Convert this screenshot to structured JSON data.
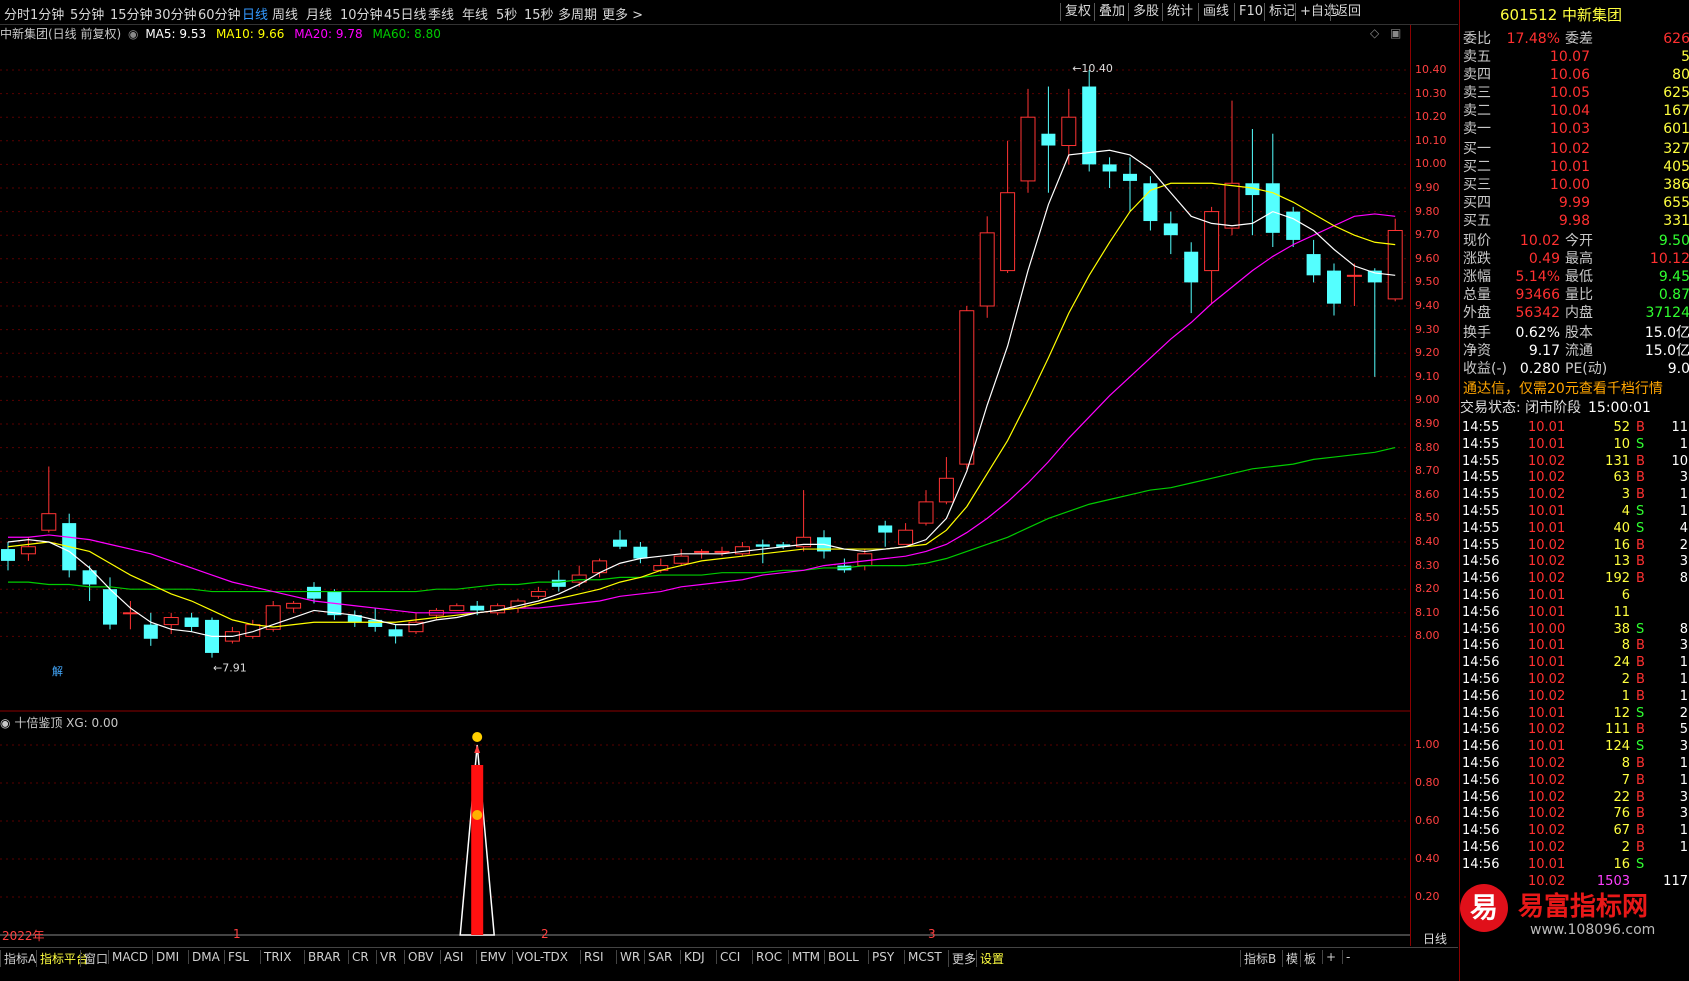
{
  "periods": [
    "分时",
    "1分钟",
    "5分钟",
    "15分钟",
    "30分钟",
    "60分钟",
    "日线",
    "周线",
    "月线",
    "10分钟",
    "45日线",
    "季线",
    "年线",
    "5秒",
    "15秒",
    "多周期",
    "更多 >"
  ],
  "right_buttons": [
    "复权",
    "叠加",
    "多股",
    "统计",
    "画线",
    "F10",
    "标记",
    "+自选",
    "返回"
  ],
  "title_line": {
    "name": "中新集团(日线 前复权)",
    "ma5": "MA5: 9.53",
    "ma10": "MA10: 9.66",
    "ma20": "MA20: 9.78",
    "ma60": "MA60: 8.80"
  },
  "colors": {
    "ma5": "#ffffff",
    "ma10": "#ffff00",
    "ma20": "#ff00ff",
    "ma60": "#00cc00",
    "up": "#ff3333",
    "down": "#54ffff"
  },
  "price_ticks": [
    "10.40",
    "10.30",
    "10.20",
    "10.10",
    "10.00",
    "9.90",
    "9.80",
    "9.70",
    "9.60",
    "9.50",
    "9.40",
    "9.30",
    "9.20",
    "9.10",
    "9.00",
    "8.90",
    "8.80",
    "8.70",
    "8.60",
    "8.50",
    "8.40",
    "8.30",
    "8.20",
    "8.10",
    "8.00"
  ],
  "annotations": {
    "high": "10.40",
    "low": "7.91",
    "jie": "解"
  },
  "sub": {
    "title": "十倍鉴顶 XG: 0.00",
    "ticks": [
      "1.00",
      "0.80",
      "0.60",
      "0.40",
      "0.20"
    ]
  },
  "date_labels": [
    "2022年",
    "1",
    "2",
    "3"
  ],
  "stock_header": "601512 中新集团",
  "weibi": {
    "label": "委比",
    "value": "17.48%",
    "label2": "委差",
    "value2": "626"
  },
  "order_book": [
    {
      "label": "卖五",
      "price": "10.07",
      "vol": "5"
    },
    {
      "label": "卖四",
      "price": "10.06",
      "vol": "80"
    },
    {
      "label": "卖三",
      "price": "10.05",
      "vol": "625"
    },
    {
      "label": "卖二",
      "price": "10.04",
      "vol": "167"
    },
    {
      "label": "卖一",
      "price": "10.03",
      "vol": "601"
    },
    {
      "label": "买一",
      "price": "10.02",
      "vol": "327"
    },
    {
      "label": "买二",
      "price": "10.01",
      "vol": "405"
    },
    {
      "label": "买三",
      "price": "10.00",
      "vol": "386"
    },
    {
      "label": "买四",
      "price": "9.99",
      "vol": "655"
    },
    {
      "label": "买五",
      "price": "9.98",
      "vol": "331"
    }
  ],
  "quote": [
    {
      "l1": "现价",
      "v1": "10.02",
      "l2": "今开",
      "v2": "9.50"
    },
    {
      "l1": "涨跌",
      "v1": "0.49",
      "l2": "最高",
      "v2": "10.12"
    },
    {
      "l1": "涨幅",
      "v1": "5.14%",
      "l2": "最低",
      "v2": "9.45"
    },
    {
      "l1": "总量",
      "v1": "93466",
      "l2": "量比",
      "v2": "0.87"
    },
    {
      "l1": "外盘",
      "v1": "56342",
      "l2": "内盘",
      "v2": "37124"
    }
  ],
  "info": [
    {
      "l1": "换手",
      "v1": "0.62%",
      "l2": "股本",
      "v2": "15.0亿"
    },
    {
      "l1": "净资",
      "v1": "9.17",
      "l2": "流通",
      "v2": "15.0亿"
    },
    {
      "l1": "收益(-)",
      "v1": "0.280",
      "l2": "PE(动)",
      "v2": "9.0"
    }
  ],
  "promo": "通达信，仅需20元查看千档行情",
  "trade_status": {
    "label": "交易状态: 闭市阶段",
    "time": "15:00:01"
  },
  "ticks": [
    {
      "t": "14:55",
      "p": "10.01",
      "v": "52",
      "d": "B",
      "n": "11"
    },
    {
      "t": "14:55",
      "p": "10.01",
      "v": "10",
      "d": "S",
      "n": "1"
    },
    {
      "t": "14:55",
      "p": "10.02",
      "v": "131",
      "d": "B",
      "n": "10"
    },
    {
      "t": "14:55",
      "p": "10.02",
      "v": "63",
      "d": "B",
      "n": "3"
    },
    {
      "t": "14:55",
      "p": "10.02",
      "v": "3",
      "d": "B",
      "n": "1"
    },
    {
      "t": "14:55",
      "p": "10.01",
      "v": "4",
      "d": "S",
      "n": "1"
    },
    {
      "t": "14:55",
      "p": "10.01",
      "v": "40",
      "d": "S",
      "n": "4"
    },
    {
      "t": "14:55",
      "p": "10.02",
      "v": "16",
      "d": "B",
      "n": "2"
    },
    {
      "t": "14:56",
      "p": "10.02",
      "v": "13",
      "d": "B",
      "n": "3"
    },
    {
      "t": "14:56",
      "p": "10.02",
      "v": "192",
      "d": "B",
      "n": "8"
    },
    {
      "t": "14:56",
      "p": "10.01",
      "v": "6",
      "d": "",
      "n": ""
    },
    {
      "t": "14:56",
      "p": "10.01",
      "v": "11",
      "d": "",
      "n": ""
    },
    {
      "t": "14:56",
      "p": "10.00",
      "v": "38",
      "d": "S",
      "n": "8"
    },
    {
      "t": "14:56",
      "p": "10.01",
      "v": "8",
      "d": "B",
      "n": "3"
    },
    {
      "t": "14:56",
      "p": "10.01",
      "v": "24",
      "d": "B",
      "n": "1"
    },
    {
      "t": "14:56",
      "p": "10.02",
      "v": "2",
      "d": "B",
      "n": "1"
    },
    {
      "t": "14:56",
      "p": "10.02",
      "v": "1",
      "d": "B",
      "n": "1"
    },
    {
      "t": "14:56",
      "p": "10.01",
      "v": "12",
      "d": "S",
      "n": "2"
    },
    {
      "t": "14:56",
      "p": "10.02",
      "v": "111",
      "d": "B",
      "n": "5"
    },
    {
      "t": "14:56",
      "p": "10.01",
      "v": "124",
      "d": "S",
      "n": "3"
    },
    {
      "t": "14:56",
      "p": "10.02",
      "v": "8",
      "d": "B",
      "n": "1"
    },
    {
      "t": "14:56",
      "p": "10.02",
      "v": "7",
      "d": "B",
      "n": "1"
    },
    {
      "t": "14:56",
      "p": "10.02",
      "v": "22",
      "d": "B",
      "n": "3"
    },
    {
      "t": "14:56",
      "p": "10.02",
      "v": "76",
      "d": "B",
      "n": "3"
    },
    {
      "t": "14:56",
      "p": "10.02",
      "v": "67",
      "d": "B",
      "n": "1"
    },
    {
      "t": "14:56",
      "p": "10.02",
      "v": "2",
      "d": "B",
      "n": "1"
    },
    {
      "t": "14:56",
      "p": "10.01",
      "v": "16",
      "d": "S",
      "n": ""
    }
  ],
  "last_tick": {
    "p": "10.02",
    "v": "1503",
    "n": "117"
  },
  "day_tab": "日线",
  "bottom_tabs": [
    "指标A",
    "指标平台",
    "窗口",
    "MACD",
    "DMI",
    "DMA",
    "FSL",
    "TRIX",
    "BRAR",
    "CR",
    "VR",
    "OBV",
    "ASI",
    "EMV",
    "VOL-TDX",
    "RSI",
    "WR",
    "SAR",
    "KDJ",
    "CCI",
    "ROC",
    "MTM",
    "BOLL",
    "PSY",
    "MCST",
    "更多",
    "设置"
  ],
  "bottom_right": [
    "指标B",
    "模",
    "板",
    "+",
    "-"
  ],
  "watermark": {
    "glyph": "易",
    "name": "易富指标网",
    "url": "www.108096.com"
  },
  "candles": [
    [
      8.37,
      8.32,
      8.4,
      8.28
    ],
    [
      8.35,
      8.38,
      8.42,
      8.32
    ],
    [
      8.45,
      8.52,
      8.72,
      8.44
    ],
    [
      8.48,
      8.28,
      8.52,
      8.25
    ],
    [
      8.28,
      8.22,
      8.3,
      8.15
    ],
    [
      8.2,
      8.05,
      8.25,
      8.03
    ],
    [
      8.1,
      8.1,
      8.15,
      8.03
    ],
    [
      8.05,
      7.99,
      8.1,
      7.96
    ],
    [
      8.05,
      8.08,
      8.1,
      8.01
    ],
    [
      8.08,
      8.04,
      8.1,
      8.02
    ],
    [
      8.07,
      7.93,
      8.08,
      7.91
    ],
    [
      7.98,
      8.02,
      8.04,
      7.97
    ],
    [
      8.0,
      8.05,
      8.07,
      7.99
    ],
    [
      8.03,
      8.13,
      8.15,
      8.02
    ],
    [
      8.12,
      8.14,
      8.15,
      8.1
    ],
    [
      8.21,
      8.16,
      8.23,
      8.14
    ],
    [
      8.19,
      8.09,
      8.2,
      8.07
    ],
    [
      8.09,
      8.06,
      8.11,
      8.04
    ],
    [
      8.07,
      8.04,
      8.12,
      8.02
    ],
    [
      8.03,
      8.0,
      8.05,
      7.97
    ],
    [
      8.02,
      8.06,
      8.1,
      8.01
    ],
    [
      8.09,
      8.11,
      8.12,
      8.07
    ],
    [
      8.11,
      8.13,
      8.14,
      8.11
    ],
    [
      8.13,
      8.11,
      8.15,
      8.09
    ],
    [
      8.1,
      8.13,
      8.14,
      8.09
    ],
    [
      8.12,
      8.15,
      8.16,
      8.1
    ],
    [
      8.17,
      8.19,
      8.21,
      8.16
    ],
    [
      8.24,
      8.21,
      8.28,
      8.19
    ],
    [
      8.23,
      8.26,
      8.3,
      8.21
    ],
    [
      8.27,
      8.32,
      8.33,
      8.25
    ],
    [
      8.41,
      8.38,
      8.45,
      8.37
    ],
    [
      8.38,
      8.33,
      8.4,
      8.31
    ],
    [
      8.28,
      8.3,
      8.33,
      8.27
    ],
    [
      8.31,
      8.34,
      8.37,
      8.3
    ],
    [
      8.36,
      8.36,
      8.37,
      8.33
    ],
    [
      8.36,
      8.36,
      8.38,
      8.34
    ],
    [
      8.35,
      8.38,
      8.4,
      8.34
    ],
    [
      8.39,
      8.38,
      8.41,
      8.31
    ],
    [
      8.39,
      8.38,
      8.4,
      8.37
    ],
    [
      8.38,
      8.42,
      8.62,
      8.36
    ],
    [
      8.42,
      8.36,
      8.45,
      8.33
    ],
    [
      8.3,
      8.28,
      8.33,
      8.27
    ],
    [
      8.3,
      8.35,
      8.37,
      8.28
    ],
    [
      8.47,
      8.44,
      8.49,
      8.38
    ],
    [
      8.39,
      8.45,
      8.48,
      8.39
    ],
    [
      8.48,
      8.57,
      8.62,
      8.47
    ],
    [
      8.57,
      8.67,
      8.76,
      8.56
    ],
    [
      8.73,
      9.38,
      9.4,
      8.71
    ],
    [
      9.4,
      9.71,
      9.78,
      9.35
    ],
    [
      9.55,
      9.88,
      10.1,
      9.54
    ],
    [
      9.93,
      10.2,
      10.32,
      9.88
    ],
    [
      10.13,
      10.08,
      10.33,
      9.88
    ],
    [
      10.08,
      10.2,
      10.32,
      10.0
    ],
    [
      10.33,
      10.0,
      10.4,
      9.97
    ],
    [
      10.0,
      9.97,
      10.03,
      9.9
    ],
    [
      9.96,
      9.93,
      10.03,
      9.8
    ],
    [
      9.92,
      9.76,
      9.95,
      9.72
    ],
    [
      9.75,
      9.7,
      9.8,
      9.62
    ],
    [
      9.63,
      9.5,
      9.67,
      9.37
    ],
    [
      9.55,
      9.8,
      9.82,
      9.41
    ],
    [
      9.73,
      9.92,
      10.27,
      9.7
    ],
    [
      9.92,
      9.87,
      10.15,
      9.7
    ],
    [
      9.92,
      9.71,
      10.13,
      9.65
    ],
    [
      9.8,
      9.68,
      9.82,
      9.65
    ],
    [
      9.62,
      9.53,
      9.68,
      9.5
    ],
    [
      9.55,
      9.41,
      9.58,
      9.36
    ],
    [
      9.53,
      9.53,
      9.58,
      9.4
    ],
    [
      9.55,
      9.5,
      9.56,
      9.1
    ],
    [
      9.43,
      9.72,
      9.77,
      9.42
    ]
  ],
  "ma5_line": [
    8.4,
    8.41,
    8.4,
    8.36,
    8.29,
    8.2,
    8.12,
    8.06,
    8.03,
    8.02,
    8.0,
    8.0,
    8.02,
    8.05,
    8.08,
    8.11,
    8.1,
    8.09,
    8.07,
    8.05,
    8.05,
    8.07,
    8.08,
    8.1,
    8.11,
    8.13,
    8.15,
    8.18,
    8.22,
    8.27,
    8.31,
    8.33,
    8.34,
    8.35,
    8.35,
    8.35,
    8.36,
    8.37,
    8.38,
    8.39,
    8.39,
    8.37,
    8.36,
    8.37,
    8.38,
    8.41,
    8.5,
    8.7,
    8.98,
    9.23,
    9.55,
    9.83,
    10.04,
    10.05,
    10.06,
    10.04,
    9.98,
    9.88,
    9.78,
    9.75,
    9.74,
    9.75,
    9.8,
    9.77,
    9.72,
    9.64,
    9.57,
    9.54,
    9.53
  ],
  "ma10_line": [
    8.38,
    8.39,
    8.4,
    8.38,
    8.36,
    8.31,
    8.26,
    8.22,
    8.18,
    8.15,
    8.11,
    8.07,
    8.05,
    8.04,
    8.05,
    8.06,
    8.06,
    8.06,
    8.06,
    8.06,
    8.07,
    8.08,
    8.09,
    8.1,
    8.11,
    8.12,
    8.14,
    8.16,
    8.18,
    8.2,
    8.23,
    8.25,
    8.28,
    8.3,
    8.32,
    8.33,
    8.34,
    8.35,
    8.36,
    8.37,
    8.37,
    8.37,
    8.37,
    8.37,
    8.38,
    8.39,
    8.45,
    8.55,
    8.69,
    8.83,
    9.0,
    9.18,
    9.37,
    9.53,
    9.67,
    9.8,
    9.89,
    9.92,
    9.92,
    9.92,
    9.91,
    9.9,
    9.88,
    9.84,
    9.79,
    9.74,
    9.7,
    9.67,
    9.66
  ],
  "ma20_line": [
    8.42,
    8.42,
    8.43,
    8.42,
    8.41,
    8.39,
    8.37,
    8.35,
    8.32,
    8.29,
    8.26,
    8.23,
    8.21,
    8.19,
    8.17,
    8.15,
    8.14,
    8.13,
    8.12,
    8.11,
    8.1,
    8.1,
    8.1,
    8.1,
    8.11,
    8.12,
    8.12,
    8.13,
    8.14,
    8.15,
    8.17,
    8.18,
    8.19,
    8.21,
    8.22,
    8.23,
    8.24,
    8.26,
    8.27,
    8.28,
    8.3,
    8.31,
    8.32,
    8.33,
    8.34,
    8.36,
    8.39,
    8.44,
    8.5,
    8.57,
    8.65,
    8.74,
    8.84,
    8.93,
    9.02,
    9.1,
    9.18,
    9.26,
    9.33,
    9.41,
    9.48,
    9.55,
    9.61,
    9.66,
    9.7,
    9.74,
    9.78,
    9.79,
    9.78
  ],
  "ma60_line": [
    8.23,
    8.23,
    8.22,
    8.22,
    8.21,
    8.21,
    8.2,
    8.2,
    8.2,
    8.2,
    8.19,
    8.19,
    8.19,
    8.19,
    8.19,
    8.19,
    8.19,
    8.19,
    8.19,
    8.19,
    8.19,
    8.2,
    8.2,
    8.21,
    8.22,
    8.22,
    8.23,
    8.23,
    8.24,
    8.24,
    8.25,
    8.25,
    8.26,
    8.26,
    8.26,
    8.27,
    8.27,
    8.27,
    8.28,
    8.28,
    8.29,
    8.29,
    8.3,
    8.3,
    8.3,
    8.31,
    8.33,
    8.36,
    8.39,
    8.42,
    8.46,
    8.5,
    8.53,
    8.56,
    8.58,
    8.6,
    8.62,
    8.63,
    8.65,
    8.67,
    8.69,
    8.71,
    8.72,
    8.73,
    8.75,
    8.76,
    8.77,
    8.78,
    8.8
  ],
  "signal": {
    "index": 23,
    "value": 1.0
  }
}
